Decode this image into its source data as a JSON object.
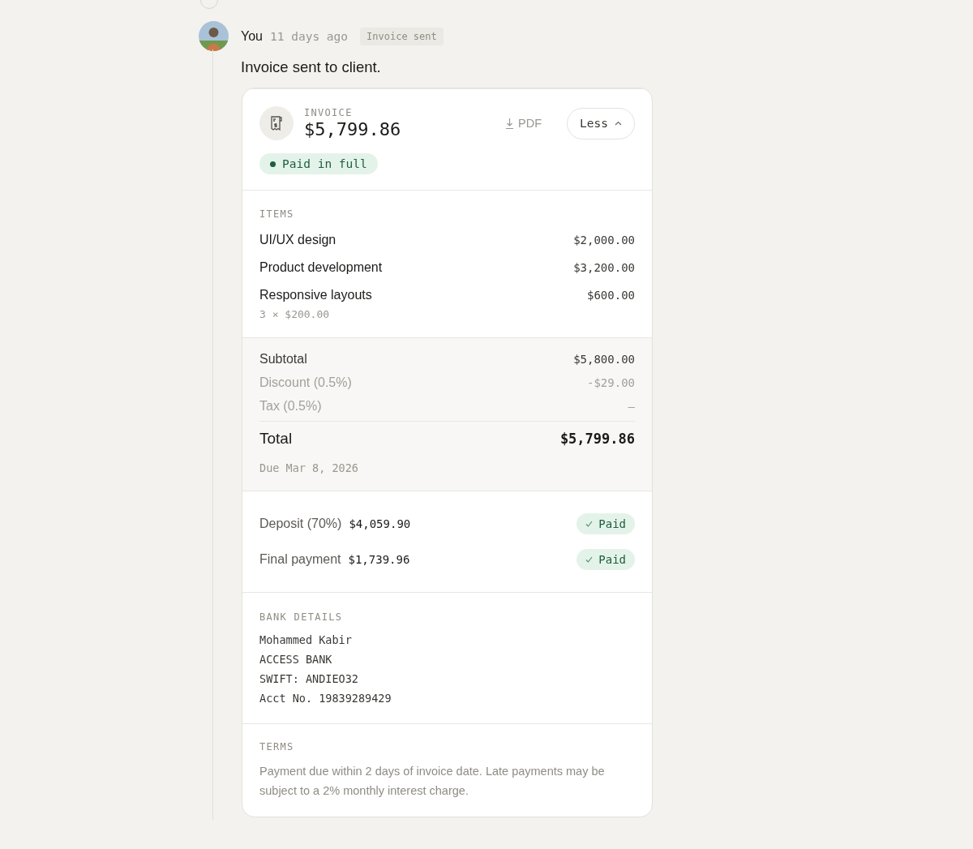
{
  "event": {
    "author": "You",
    "time": "11 days ago",
    "tag": "Invoice sent",
    "message": "Invoice sent to client."
  },
  "invoice": {
    "label": "INVOICE",
    "amount": "$5,799.86",
    "pdf": "PDF",
    "toggle": "Less",
    "expanded": true,
    "status": "Paid in full",
    "items_label": "ITEMS",
    "items": [
      {
        "name": "UI/UX design",
        "amount": "$2,000.00"
      },
      {
        "name": "Product development",
        "amount": "$3,200.00"
      },
      {
        "name": "Responsive layouts",
        "amount": "$600.00",
        "detail": "3 × $200.00"
      }
    ],
    "summary": [
      {
        "label": "Subtotal",
        "value": "$5,800.00",
        "muted": false
      },
      {
        "label": "Discount (0.5%)",
        "value": "-$29.00",
        "muted": true
      },
      {
        "label": "Tax (0.5%)",
        "value": "—",
        "muted": true
      }
    ],
    "total": {
      "label": "Total",
      "value": "$5,799.86"
    },
    "due": "Due Mar 8, 2026",
    "payments": [
      {
        "label": "Deposit (70%)",
        "amount": "$4,059.90",
        "status": "Paid",
        "paid": true
      },
      {
        "label": "Final payment",
        "amount": "$1,739.96",
        "status": "Paid",
        "paid": true
      }
    ],
    "bank_label": "BANK DETAILS",
    "bank_lines": [
      "Mohammed Kabir",
      "ACCESS BANK",
      "SWIFT: ANDIEO32",
      "Acct No. 19839289429"
    ],
    "terms_label": "TERMS",
    "terms": "Payment due within 2 days of invoice date. Late payments may be subject to a 2% monthly interest charge."
  }
}
